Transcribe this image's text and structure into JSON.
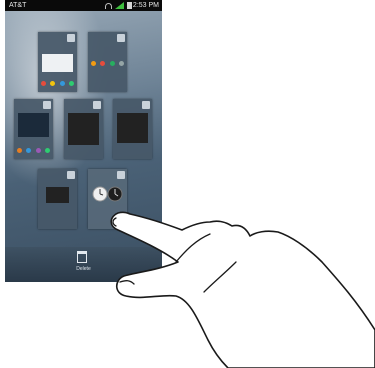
{
  "status_bar": {
    "carrier": "AT&T",
    "time": "2:53 PM",
    "icons": [
      "wifi-icon",
      "signal-icon",
      "battery-icon"
    ]
  },
  "pages": [
    {
      "name": "home-page-1",
      "content": "widget-light"
    },
    {
      "name": "home-page-2",
      "content": "app-icons"
    },
    {
      "name": "home-page-3",
      "content": "widget-light"
    },
    {
      "name": "home-page-4",
      "content": "widget-dark"
    },
    {
      "name": "home-page-5",
      "content": "widget-dark"
    },
    {
      "name": "home-page-6",
      "content": "widget-dark"
    },
    {
      "name": "home-page-7",
      "content": "clock-widgets"
    }
  ],
  "trash": {
    "label": "Delete",
    "icon": "trash-icon"
  },
  "colors": {
    "wallpaper_top": "#9aaab8",
    "wallpaper_bottom": "#3b4f62",
    "status_bar": "#0a0a0a"
  },
  "overlay": {
    "icon": "pointing-hand-icon"
  }
}
